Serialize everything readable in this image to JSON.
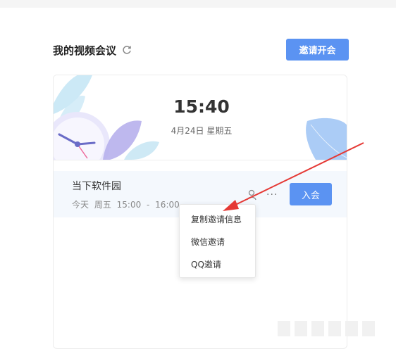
{
  "header": {
    "title": "我的视频会议",
    "invite_label": "邀请开会"
  },
  "banner": {
    "time": "15:40",
    "date": "4月24日 星期五"
  },
  "meeting": {
    "name": "当下软件园",
    "schedule": "今天 周五 15:00 - 16:00",
    "join_label": "入会"
  },
  "context_menu": {
    "items": [
      {
        "label": "复制邀请信息"
      },
      {
        "label": "微信邀请"
      },
      {
        "label": "QQ邀请"
      }
    ]
  },
  "colors": {
    "accent": "#5b93f2",
    "arrow": "#e53935",
    "meeting_bg": "#f4f8fd"
  }
}
